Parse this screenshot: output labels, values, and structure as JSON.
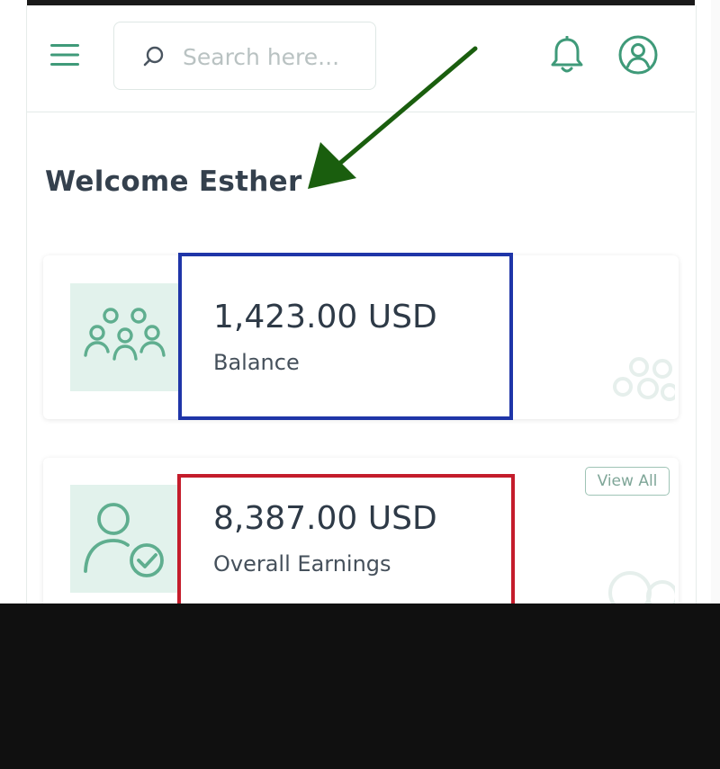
{
  "header": {
    "search_placeholder": "Search here..."
  },
  "welcome_text": "Welcome Esther",
  "cards": [
    {
      "amount": "1,423.00 USD",
      "label": "Balance"
    },
    {
      "amount": "8,387.00 USD",
      "label": "Overall Earnings",
      "action_label": "View All"
    }
  ],
  "colors": {
    "accent_green": "#3f9a79",
    "icon_bg": "#e2f2ec",
    "text_dark": "#2e3a47",
    "arrow": "#1a5e0e",
    "highlight_blue": "#1f35a8",
    "highlight_red": "#c41c2b"
  },
  "icons": {
    "menu": "hamburger-icon",
    "search": "search-icon",
    "notifications": "bell-icon",
    "account": "user-circle-icon",
    "balance": "users-group-icon",
    "earnings": "user-check-icon"
  }
}
